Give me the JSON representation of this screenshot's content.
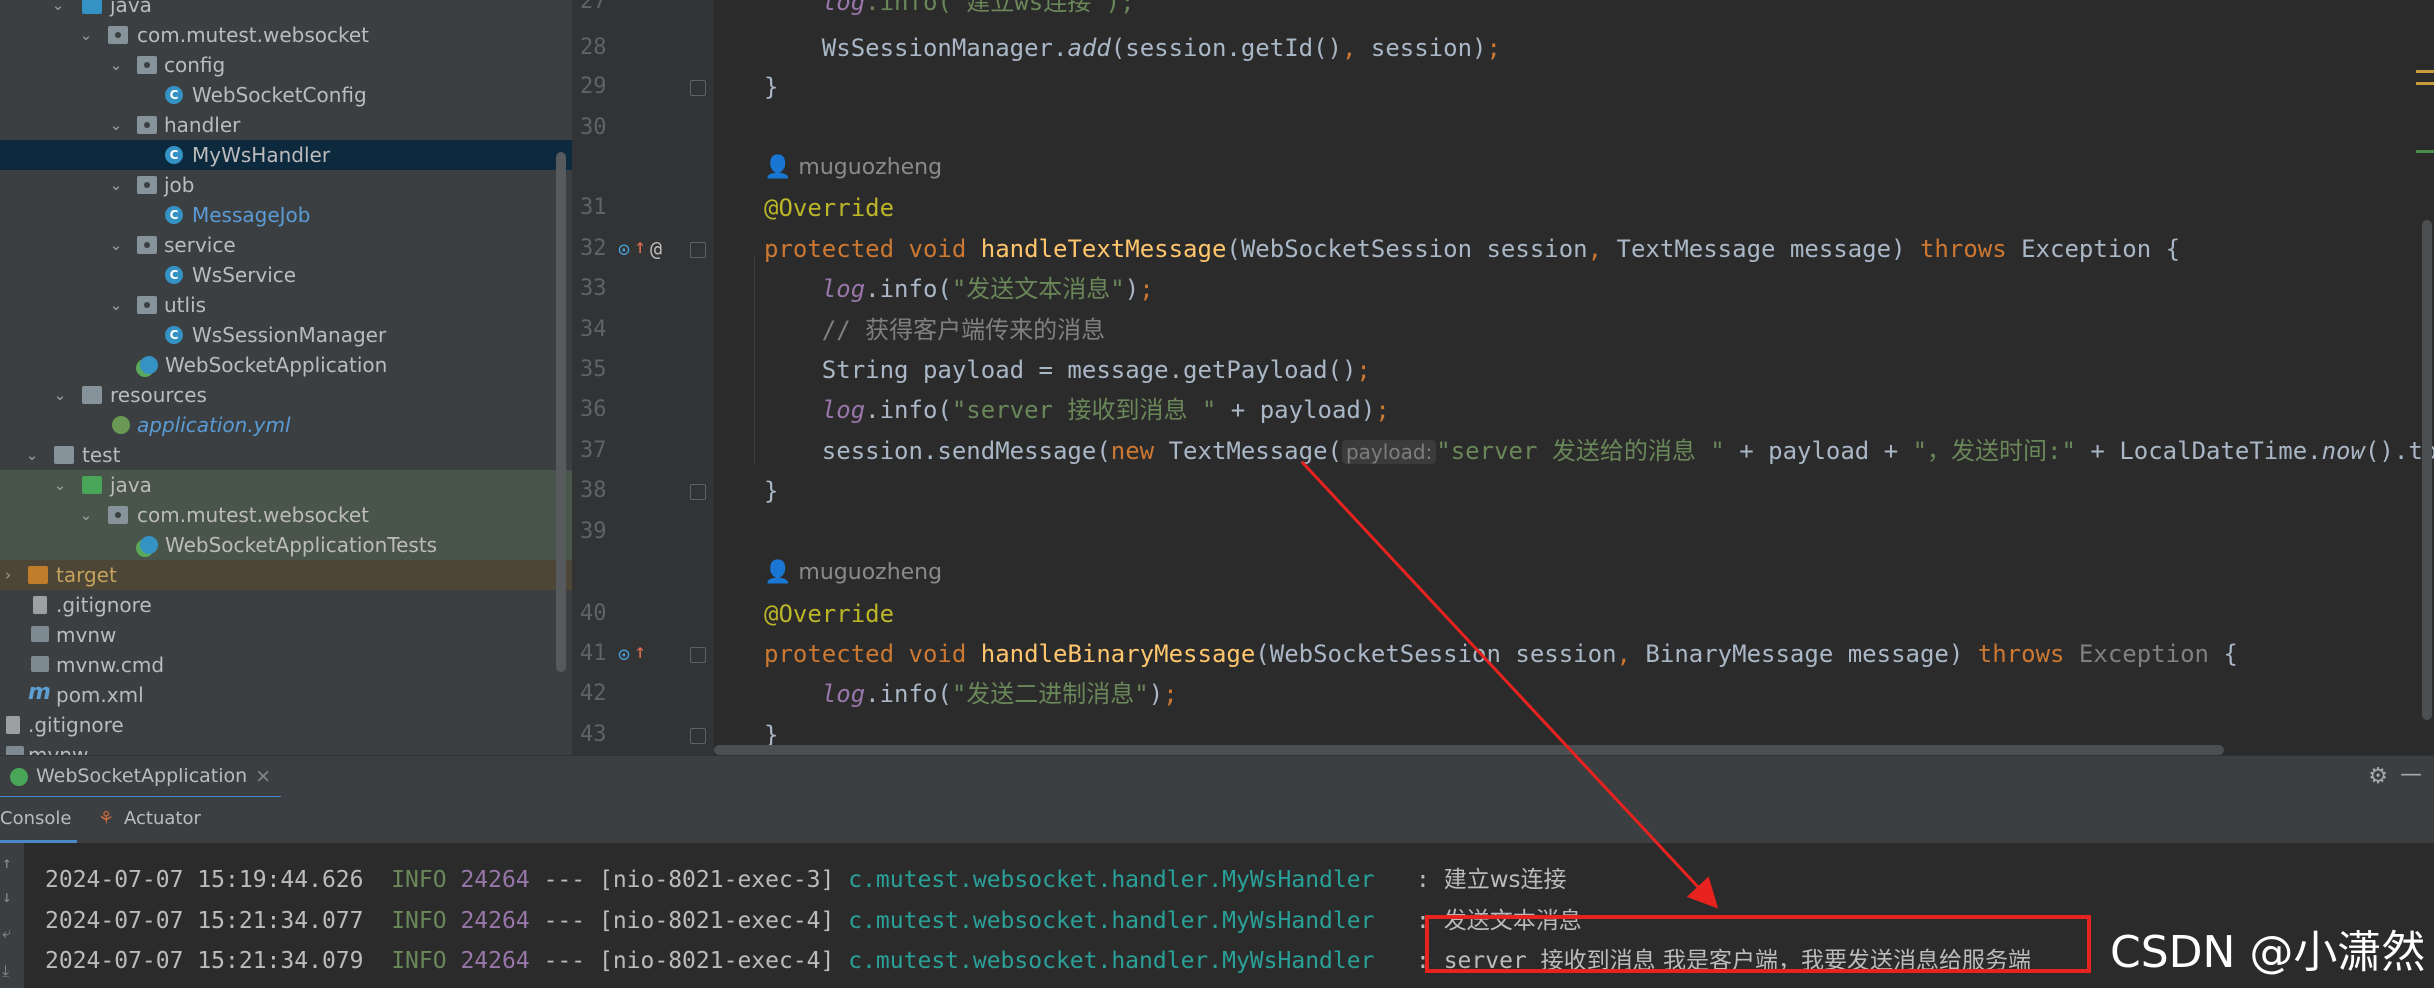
{
  "project_tree": {
    "items": [
      {
        "label": "java"
      },
      {
        "label": "com.mutest.websocket"
      },
      {
        "label": "config"
      },
      {
        "label": "WebSocketConfig"
      },
      {
        "label": "handler"
      },
      {
        "label": "MyWsHandler"
      },
      {
        "label": "job"
      },
      {
        "label": "MessageJob"
      },
      {
        "label": "service"
      },
      {
        "label": "WsService"
      },
      {
        "label": "utlis"
      },
      {
        "label": "WsSessionManager"
      },
      {
        "label": "WebSocketApplication"
      },
      {
        "label": "resources"
      },
      {
        "label": "application.yml"
      },
      {
        "label": "test"
      },
      {
        "label": "java"
      },
      {
        "label": "com.mutest.websocket"
      },
      {
        "label": "WebSocketApplicationTests"
      },
      {
        "label": "target"
      },
      {
        "label": ".gitignore"
      },
      {
        "label": "mvnw"
      },
      {
        "label": "mvnw.cmd"
      },
      {
        "label": "pom.xml"
      },
      {
        "label": ".gitignore"
      },
      {
        "label": "mvnw"
      }
    ]
  },
  "editor": {
    "line_numbers": [
      "27",
      "28",
      "29",
      "30",
      "31",
      "32",
      "33",
      "34",
      "35",
      "36",
      "37",
      "38",
      "39",
      "40",
      "41",
      "42",
      "43"
    ],
    "author": "muguozheng",
    "tokens": {
      "log": "log",
      "info_ws_connect": ".info(\"建立ws连接\");",
      "l28_a": "WsSessionManager.",
      "l28_add": "add",
      "l28_b": "(session.getId()",
      "l28_comma": ",",
      "l28_c": " session)",
      "semi": ";",
      "close_brace": "}",
      "override": "@Override",
      "protected": "protected",
      "void": " void ",
      "handleTextMessage": "handleTextMessage",
      "l32_params_a": "(WebSocketSession session",
      "l32_params_b": " TextMessage message) ",
      "throws": "throws",
      "exception_brace": " Exception {",
      "l33_str": "\"发送文本消息\"",
      "l34_comment": "// 获得客户端传来的消息",
      "l35": "String payload = message.getPayload()",
      "l36_str": "\"server 接收到消息 \"",
      "l36_rest": " + payload)",
      "l37_a": "session.sendMessage(",
      "l37_new": "new",
      "l37_b": " TextMessage(",
      "l37_hint": "payload:",
      "l37_str1": "\"server 发送给的消息 \"",
      "l37_c": " + payload + ",
      "l37_str2": "\"，发送时间:\"",
      "l37_d": " + LocalDateTime.",
      "l37_now": "now",
      "l37_e": "().toSt",
      "handleBinaryMessage": "handleBinaryMessage",
      "l41_params_a": "(WebSocketSession session",
      "l41_params_b": " BinaryMessage message) ",
      "l41_exception": " Exception",
      "l41_brace": " {",
      "l42_str": "\"发送二进制消息\"",
      "info_open": ".info(",
      "paren_close": ")"
    }
  },
  "run_panel": {
    "tab_label": "WebSocketApplication",
    "tab_close": "×",
    "subtabs": {
      "console": "Console",
      "actuator": "Actuator"
    },
    "gear": "⚙",
    "minimize": "—",
    "logs": [
      {
        "ts": "2024-07-07 15:19:44.626",
        "level": "INFO",
        "pid": "24264",
        "sep": "---",
        "thread": "[nio-8021-exec-3]",
        "logger": "c.mutest.websocket.handler.MyWsHandler",
        "colon": ":",
        "msg": "建立ws连接"
      },
      {
        "ts": "2024-07-07 15:21:34.077",
        "level": "INFO",
        "pid": "24264",
        "sep": "---",
        "thread": "[nio-8021-exec-4]",
        "logger": "c.mutest.websocket.handler.MyWsHandler",
        "colon": ":",
        "msg": "发送文本消息"
      },
      {
        "ts": "2024-07-07 15:21:34.079",
        "level": "INFO",
        "pid": "24264",
        "sep": "---",
        "thread": "[nio-8021-exec-4]",
        "logger": "c.mutest.websocket.handler.MyWsHandler",
        "colon": ":",
        "msg_prefix": "server",
        "msg": "接收到消息 我是客户端，我要发送消息给服务端"
      }
    ]
  },
  "watermark": "CSDN @小潇然",
  "colors": {
    "annotation_red": "#e8231f",
    "keyword": "#cc7832",
    "string": "#6a8759",
    "method": "#ffc66d"
  }
}
